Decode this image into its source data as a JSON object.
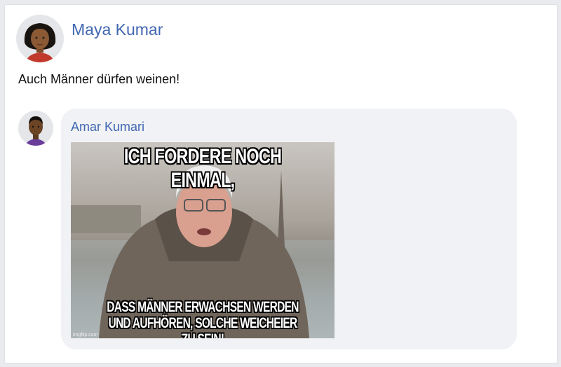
{
  "post": {
    "author": "Maya Kumar",
    "text": "Auch Männer dürfen weinen!"
  },
  "comment": {
    "author": "Amar Kumari",
    "meme": {
      "top_text": "ICH FORDERE NOCH EINMAL,",
      "bottom_line1": "DASS MÄNNER ERWACHSEN WERDEN",
      "bottom_line2": "UND AUFHÖREN, SOLCHE WEICHEIER ZU SEIN!",
      "watermark": "imgflip.com"
    }
  },
  "colors": {
    "name": "#4267b2",
    "bubble": "#f0f2f5"
  }
}
